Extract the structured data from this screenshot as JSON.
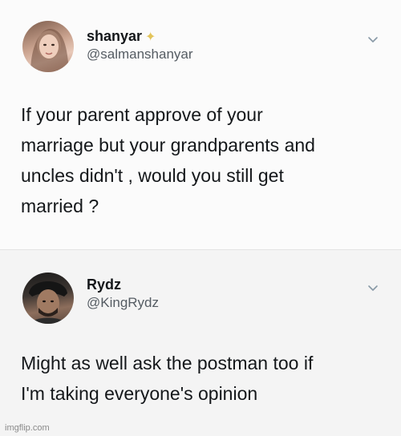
{
  "tweets": [
    {
      "display_name": "shanyar",
      "badge_icon": "sparkle-icon",
      "handle": "@salmanshanyar",
      "text": "If your parent approve of your\nmarriage but your grandparents and\nuncles didn't , would you still get\nmarried ?"
    },
    {
      "display_name": "Rydz",
      "handle": "@KingRydz",
      "text": "Might as well ask the postman too if\nI'm taking everyone's opinion"
    }
  ],
  "watermark": "imgflip.com",
  "colors": {
    "name": "#14171a",
    "handle": "#555c63",
    "sparkle": "#e3c45a"
  }
}
